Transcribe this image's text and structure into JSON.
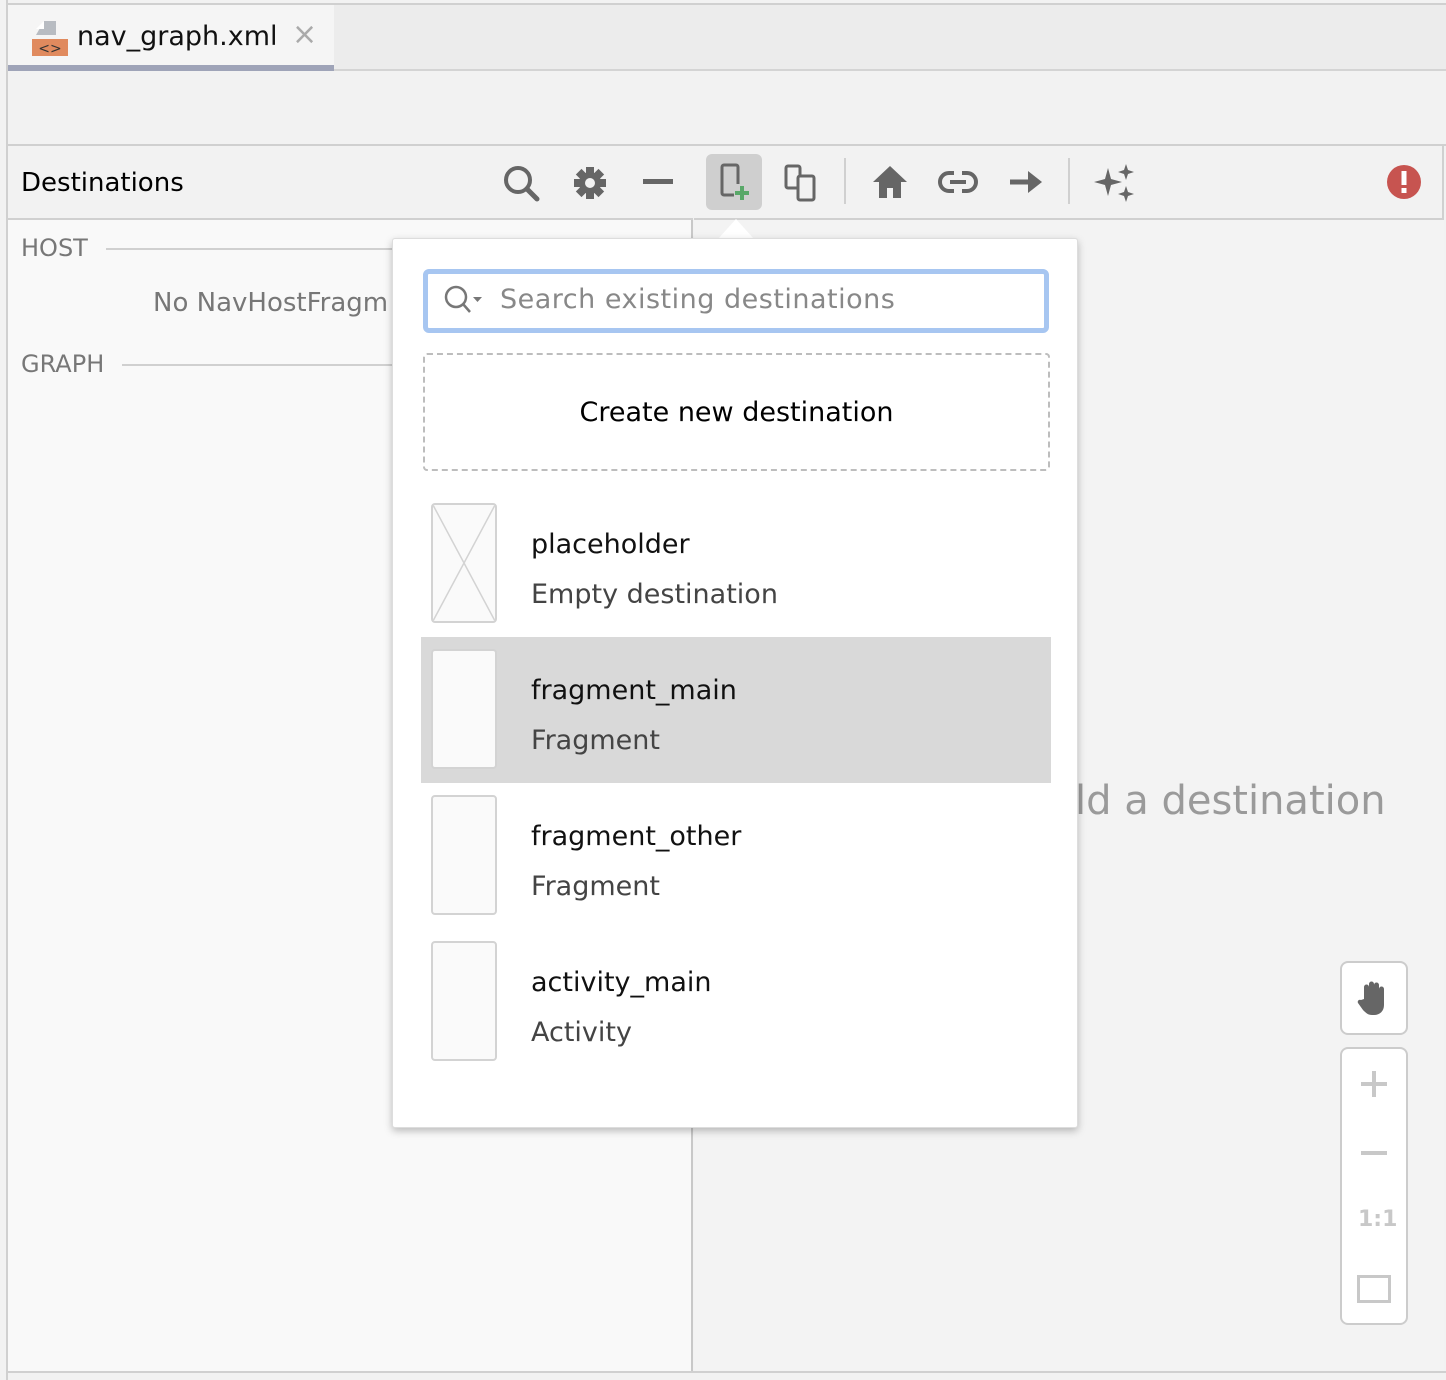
{
  "tab": {
    "label": "nav_graph.xml",
    "icon": "xml-file-icon",
    "close_icon": "close-icon"
  },
  "panel": {
    "title": "Destinations",
    "sections": {
      "host": "HOST",
      "host_empty": "No NavHostFragm",
      "graph": "GRAPH"
    }
  },
  "toolbar": {
    "icons": [
      "new-destination-icon",
      "nested-graph-icon",
      "home-icon",
      "deeplink-icon",
      "action-arrow-icon",
      "auto-arrange-icon",
      "error-icon"
    ],
    "error_color": "#c75450",
    "new_dest_plus_color": "#59a869"
  },
  "canvas": {
    "hint": "ld a destination"
  },
  "zoom_controls": {
    "icons": [
      "pan-hand-icon",
      "zoom-in-icon",
      "zoom-out-icon",
      "actual-size-icon",
      "fit-screen-icon"
    ],
    "actual_size_label": "1:1"
  },
  "popup": {
    "search_placeholder": "Search existing destinations",
    "create_label": "Create new destination",
    "items": [
      {
        "name": "placeholder",
        "type": "Empty destination",
        "selected": false
      },
      {
        "name": "fragment_main",
        "type": "Fragment",
        "selected": true
      },
      {
        "name": "fragment_other",
        "type": "Fragment",
        "selected": false
      },
      {
        "name": "activity_main",
        "type": "Activity",
        "selected": false
      }
    ]
  }
}
